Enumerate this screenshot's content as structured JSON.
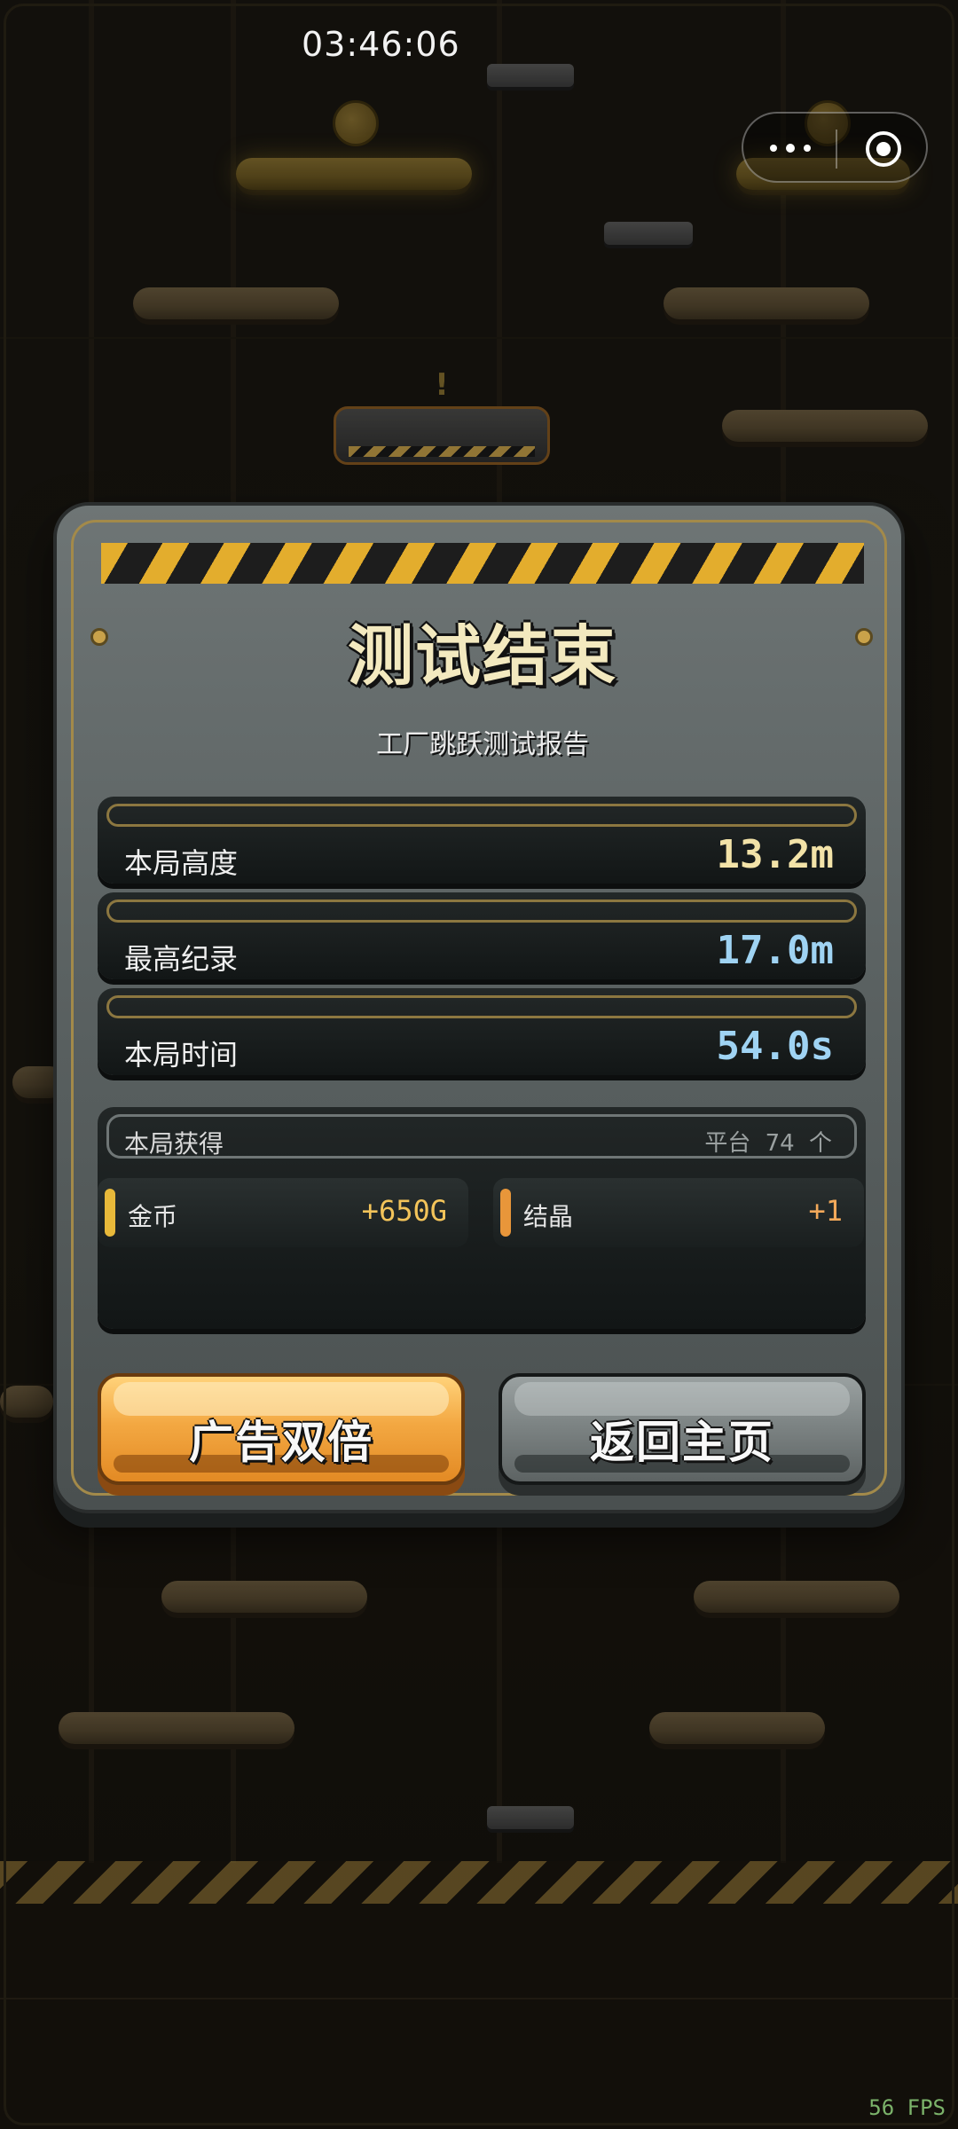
{
  "status": {
    "time": "03:46:06",
    "fps": "56 FPS"
  },
  "capsule": {
    "menu_icon": "more-dots-icon",
    "close_icon": "target-circle-icon"
  },
  "dialog": {
    "title": "测试结束",
    "subtitle": "工厂跳跃测试报告",
    "stats": [
      {
        "label": "本局高度",
        "value": "13.2m",
        "color": "#f3e3a8"
      },
      {
        "label": "最高纪录",
        "value": "17.0m",
        "color": "#9fd3f3"
      },
      {
        "label": "本局时间",
        "value": "54.0s",
        "color": "#9fd3f3"
      }
    ],
    "earnings": {
      "title": "本局获得",
      "platform_label": "平台",
      "platform_count": "74",
      "platform_unit": "个",
      "items": [
        {
          "name": "金币",
          "amount": "+650G",
          "accent": "#e8b93a",
          "amount_color": "#f3c45a"
        },
        {
          "name": "结晶",
          "amount": "+1",
          "accent": "#e8963a",
          "amount_color": "#f3a95a"
        }
      ]
    },
    "buttons": {
      "ad_double": "广告双倍",
      "home": "返回主页"
    }
  },
  "colors": {
    "accent": "#e3ad2d",
    "button_orange": "#f3a842",
    "panel": "#5b6262"
  }
}
